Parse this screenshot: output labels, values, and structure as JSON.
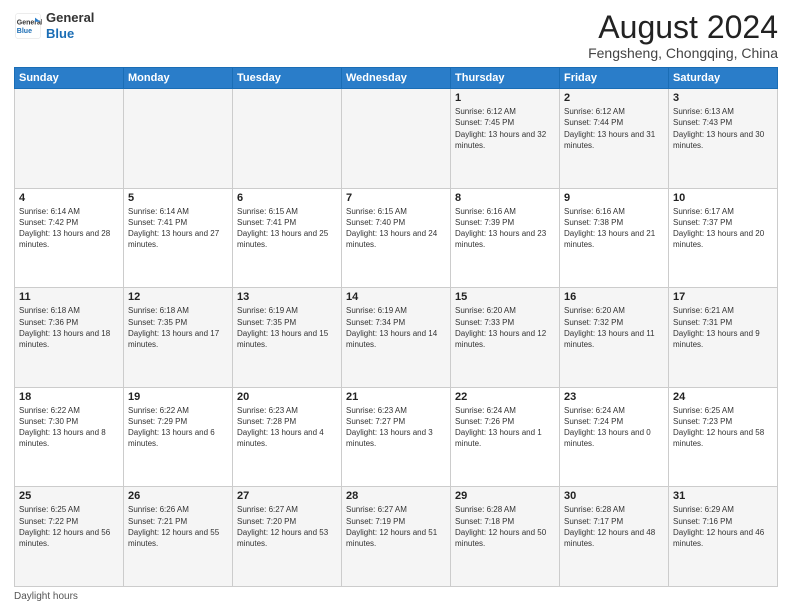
{
  "logo": {
    "general": "General",
    "blue": "Blue"
  },
  "header": {
    "title": "August 2024",
    "subtitle": "Fengsheng, Chongqing, China"
  },
  "weekdays": [
    "Sunday",
    "Monday",
    "Tuesday",
    "Wednesday",
    "Thursday",
    "Friday",
    "Saturday"
  ],
  "footer": {
    "daylight_label": "Daylight hours"
  },
  "weeks": [
    [
      {
        "day": "",
        "info": ""
      },
      {
        "day": "",
        "info": ""
      },
      {
        "day": "",
        "info": ""
      },
      {
        "day": "",
        "info": ""
      },
      {
        "day": "1",
        "info": "Sunrise: 6:12 AM\nSunset: 7:45 PM\nDaylight: 13 hours and 32 minutes."
      },
      {
        "day": "2",
        "info": "Sunrise: 6:12 AM\nSunset: 7:44 PM\nDaylight: 13 hours and 31 minutes."
      },
      {
        "day": "3",
        "info": "Sunrise: 6:13 AM\nSunset: 7:43 PM\nDaylight: 13 hours and 30 minutes."
      }
    ],
    [
      {
        "day": "4",
        "info": "Sunrise: 6:14 AM\nSunset: 7:42 PM\nDaylight: 13 hours and 28 minutes."
      },
      {
        "day": "5",
        "info": "Sunrise: 6:14 AM\nSunset: 7:41 PM\nDaylight: 13 hours and 27 minutes."
      },
      {
        "day": "6",
        "info": "Sunrise: 6:15 AM\nSunset: 7:41 PM\nDaylight: 13 hours and 25 minutes."
      },
      {
        "day": "7",
        "info": "Sunrise: 6:15 AM\nSunset: 7:40 PM\nDaylight: 13 hours and 24 minutes."
      },
      {
        "day": "8",
        "info": "Sunrise: 6:16 AM\nSunset: 7:39 PM\nDaylight: 13 hours and 23 minutes."
      },
      {
        "day": "9",
        "info": "Sunrise: 6:16 AM\nSunset: 7:38 PM\nDaylight: 13 hours and 21 minutes."
      },
      {
        "day": "10",
        "info": "Sunrise: 6:17 AM\nSunset: 7:37 PM\nDaylight: 13 hours and 20 minutes."
      }
    ],
    [
      {
        "day": "11",
        "info": "Sunrise: 6:18 AM\nSunset: 7:36 PM\nDaylight: 13 hours and 18 minutes."
      },
      {
        "day": "12",
        "info": "Sunrise: 6:18 AM\nSunset: 7:35 PM\nDaylight: 13 hours and 17 minutes."
      },
      {
        "day": "13",
        "info": "Sunrise: 6:19 AM\nSunset: 7:35 PM\nDaylight: 13 hours and 15 minutes."
      },
      {
        "day": "14",
        "info": "Sunrise: 6:19 AM\nSunset: 7:34 PM\nDaylight: 13 hours and 14 minutes."
      },
      {
        "day": "15",
        "info": "Sunrise: 6:20 AM\nSunset: 7:33 PM\nDaylight: 13 hours and 12 minutes."
      },
      {
        "day": "16",
        "info": "Sunrise: 6:20 AM\nSunset: 7:32 PM\nDaylight: 13 hours and 11 minutes."
      },
      {
        "day": "17",
        "info": "Sunrise: 6:21 AM\nSunset: 7:31 PM\nDaylight: 13 hours and 9 minutes."
      }
    ],
    [
      {
        "day": "18",
        "info": "Sunrise: 6:22 AM\nSunset: 7:30 PM\nDaylight: 13 hours and 8 minutes."
      },
      {
        "day": "19",
        "info": "Sunrise: 6:22 AM\nSunset: 7:29 PM\nDaylight: 13 hours and 6 minutes."
      },
      {
        "day": "20",
        "info": "Sunrise: 6:23 AM\nSunset: 7:28 PM\nDaylight: 13 hours and 4 minutes."
      },
      {
        "day": "21",
        "info": "Sunrise: 6:23 AM\nSunset: 7:27 PM\nDaylight: 13 hours and 3 minutes."
      },
      {
        "day": "22",
        "info": "Sunrise: 6:24 AM\nSunset: 7:26 PM\nDaylight: 13 hours and 1 minute."
      },
      {
        "day": "23",
        "info": "Sunrise: 6:24 AM\nSunset: 7:24 PM\nDaylight: 13 hours and 0 minutes."
      },
      {
        "day": "24",
        "info": "Sunrise: 6:25 AM\nSunset: 7:23 PM\nDaylight: 12 hours and 58 minutes."
      }
    ],
    [
      {
        "day": "25",
        "info": "Sunrise: 6:25 AM\nSunset: 7:22 PM\nDaylight: 12 hours and 56 minutes."
      },
      {
        "day": "26",
        "info": "Sunrise: 6:26 AM\nSunset: 7:21 PM\nDaylight: 12 hours and 55 minutes."
      },
      {
        "day": "27",
        "info": "Sunrise: 6:27 AM\nSunset: 7:20 PM\nDaylight: 12 hours and 53 minutes."
      },
      {
        "day": "28",
        "info": "Sunrise: 6:27 AM\nSunset: 7:19 PM\nDaylight: 12 hours and 51 minutes."
      },
      {
        "day": "29",
        "info": "Sunrise: 6:28 AM\nSunset: 7:18 PM\nDaylight: 12 hours and 50 minutes."
      },
      {
        "day": "30",
        "info": "Sunrise: 6:28 AM\nSunset: 7:17 PM\nDaylight: 12 hours and 48 minutes."
      },
      {
        "day": "31",
        "info": "Sunrise: 6:29 AM\nSunset: 7:16 PM\nDaylight: 12 hours and 46 minutes."
      }
    ]
  ]
}
